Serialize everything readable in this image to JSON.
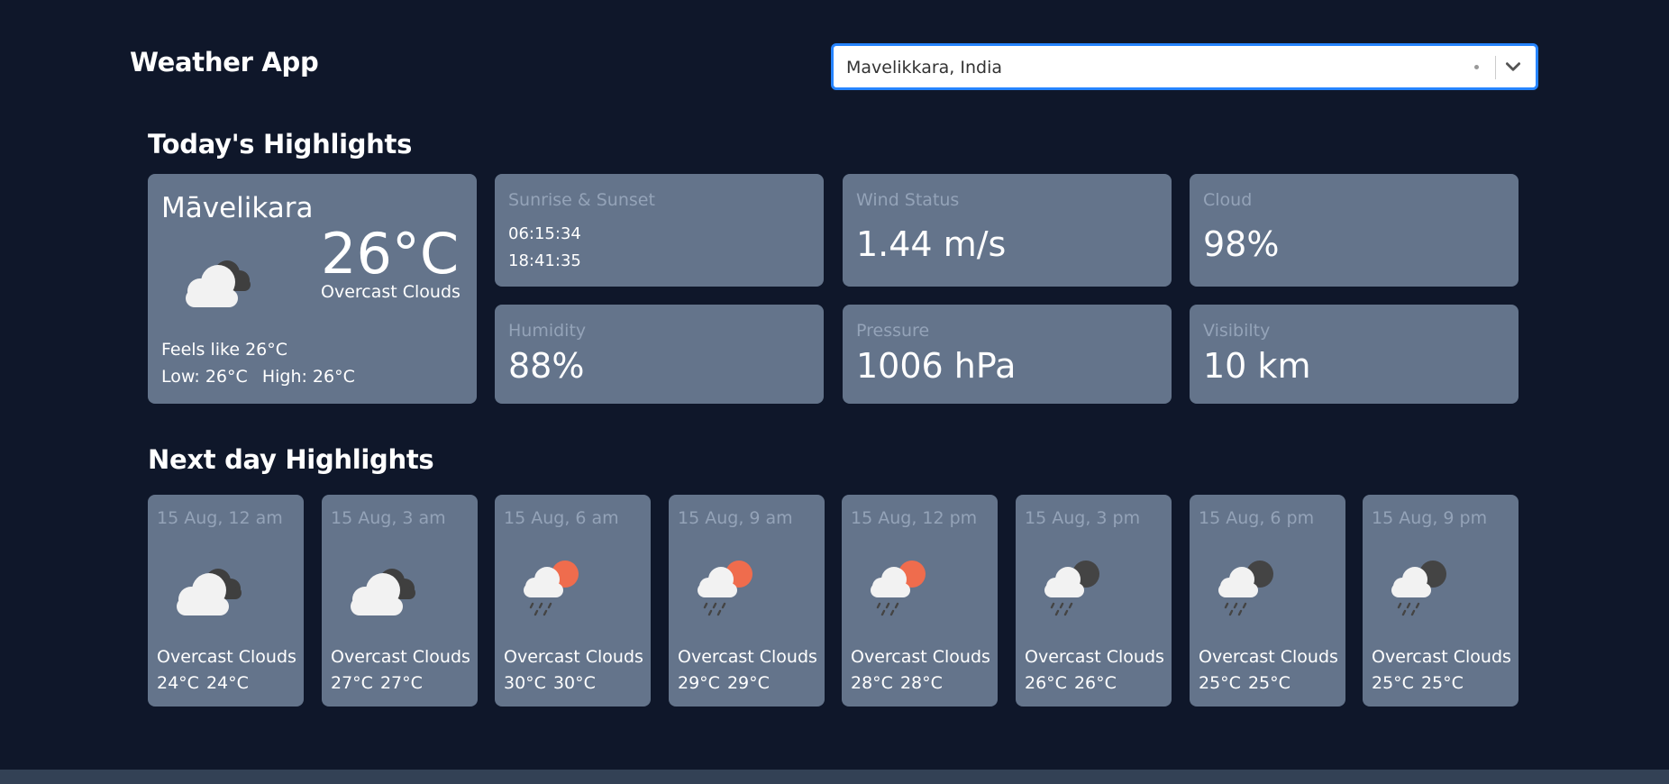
{
  "header": {
    "title": "Weather App",
    "search": {
      "value": "Mavelikkara, India"
    }
  },
  "today": {
    "section_title": "Today's Highlights",
    "main": {
      "city": "Māvelikara",
      "temp": "26°C",
      "description": "Overcast Clouds",
      "feels_like": "Feels like 26°C",
      "low": "Low: 26°C",
      "high": "High: 26°C",
      "icon": "overcast-clouds-icon"
    },
    "sun": {
      "label": "Sunrise & Sunset",
      "sunrise": "06:15:34",
      "sunset": "18:41:35"
    },
    "wind": {
      "label": "Wind Status",
      "value": "1.44 m/s"
    },
    "cloud": {
      "label": "Cloud",
      "value": "98%"
    },
    "humidity": {
      "label": "Humidity",
      "value": "88%"
    },
    "pressure": {
      "label": "Pressure",
      "value": "1006 hPa"
    },
    "visibility": {
      "label": "Visibilty",
      "value": "10 km"
    }
  },
  "next": {
    "section_title": "Next day Highlights",
    "items": [
      {
        "time": "15 Aug, 12 am",
        "description": "Overcast Clouds",
        "temp_min": "24°C",
        "temp_max": "24°C",
        "icon": "overcast-clouds-icon"
      },
      {
        "time": "15 Aug, 3 am",
        "description": "Overcast Clouds",
        "temp_min": "27°C",
        "temp_max": "27°C",
        "icon": "overcast-clouds-icon"
      },
      {
        "time": "15 Aug, 6 am",
        "description": "Overcast Clouds",
        "temp_min": "30°C",
        "temp_max": "30°C",
        "icon": "rain-day-icon"
      },
      {
        "time": "15 Aug, 9 am",
        "description": "Overcast Clouds",
        "temp_min": "29°C",
        "temp_max": "29°C",
        "icon": "rain-day-icon"
      },
      {
        "time": "15 Aug, 12 pm",
        "description": "Overcast Clouds",
        "temp_min": "28°C",
        "temp_max": "28°C",
        "icon": "rain-day-icon"
      },
      {
        "time": "15 Aug, 3 pm",
        "description": "Overcast Clouds",
        "temp_min": "26°C",
        "temp_max": "26°C",
        "icon": "rain-night-icon"
      },
      {
        "time": "15 Aug, 6 pm",
        "description": "Overcast Clouds",
        "temp_min": "25°C",
        "temp_max": "25°C",
        "icon": "rain-night-icon"
      },
      {
        "time": "15 Aug, 9 pm",
        "description": "Overcast Clouds",
        "temp_min": "25°C",
        "temp_max": "25°C",
        "icon": "rain-night-icon"
      }
    ]
  },
  "colors": {
    "background": "#0f172a",
    "card": "#64748b",
    "label": "#94a3b8",
    "accent": "#2684ff",
    "sun": "#ef6c4d",
    "moon": "#444444"
  }
}
